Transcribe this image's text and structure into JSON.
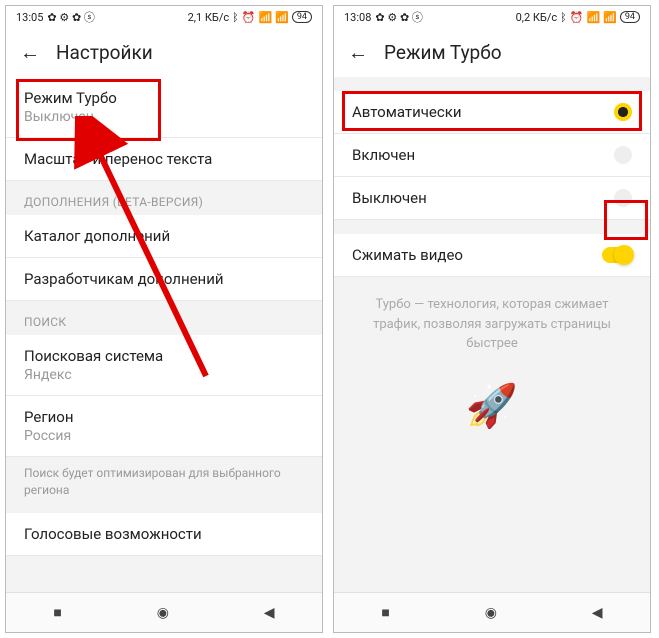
{
  "left": {
    "status": {
      "time": "13:05",
      "speed": "2,1 КБ/с",
      "battery": "94"
    },
    "header": {
      "title": "Настройки"
    },
    "turbo": {
      "title": "Режим Турбо",
      "status": "Выключен"
    },
    "scale": {
      "title": "Масштаб и перенос текста"
    },
    "extensions": {
      "header": "ДОПОЛНЕНИЯ (БЕТА-ВЕРСИЯ)",
      "catalog": "Каталог дополнений",
      "devs": "Разработчикам дополнений"
    },
    "search": {
      "header": "ПОИСК",
      "engine": {
        "title": "Поисковая система",
        "value": "Яндекс"
      },
      "region": {
        "title": "Регион",
        "value": "Россия"
      },
      "note": "Поиск будет оптимизирован для выбранного региона",
      "voice": "Голосовые возможности"
    }
  },
  "right": {
    "status": {
      "time": "13:08",
      "speed": "0,2 КБ/с",
      "battery": "94"
    },
    "header": {
      "title": "Режим Турбо"
    },
    "options": {
      "auto": "Автоматически",
      "on": "Включен",
      "off": "Выключен",
      "compress": "Сжимать видео"
    },
    "desc": "Турбо — технология, которая сжимает трафик, позволяя загружать страницы быстрее"
  }
}
